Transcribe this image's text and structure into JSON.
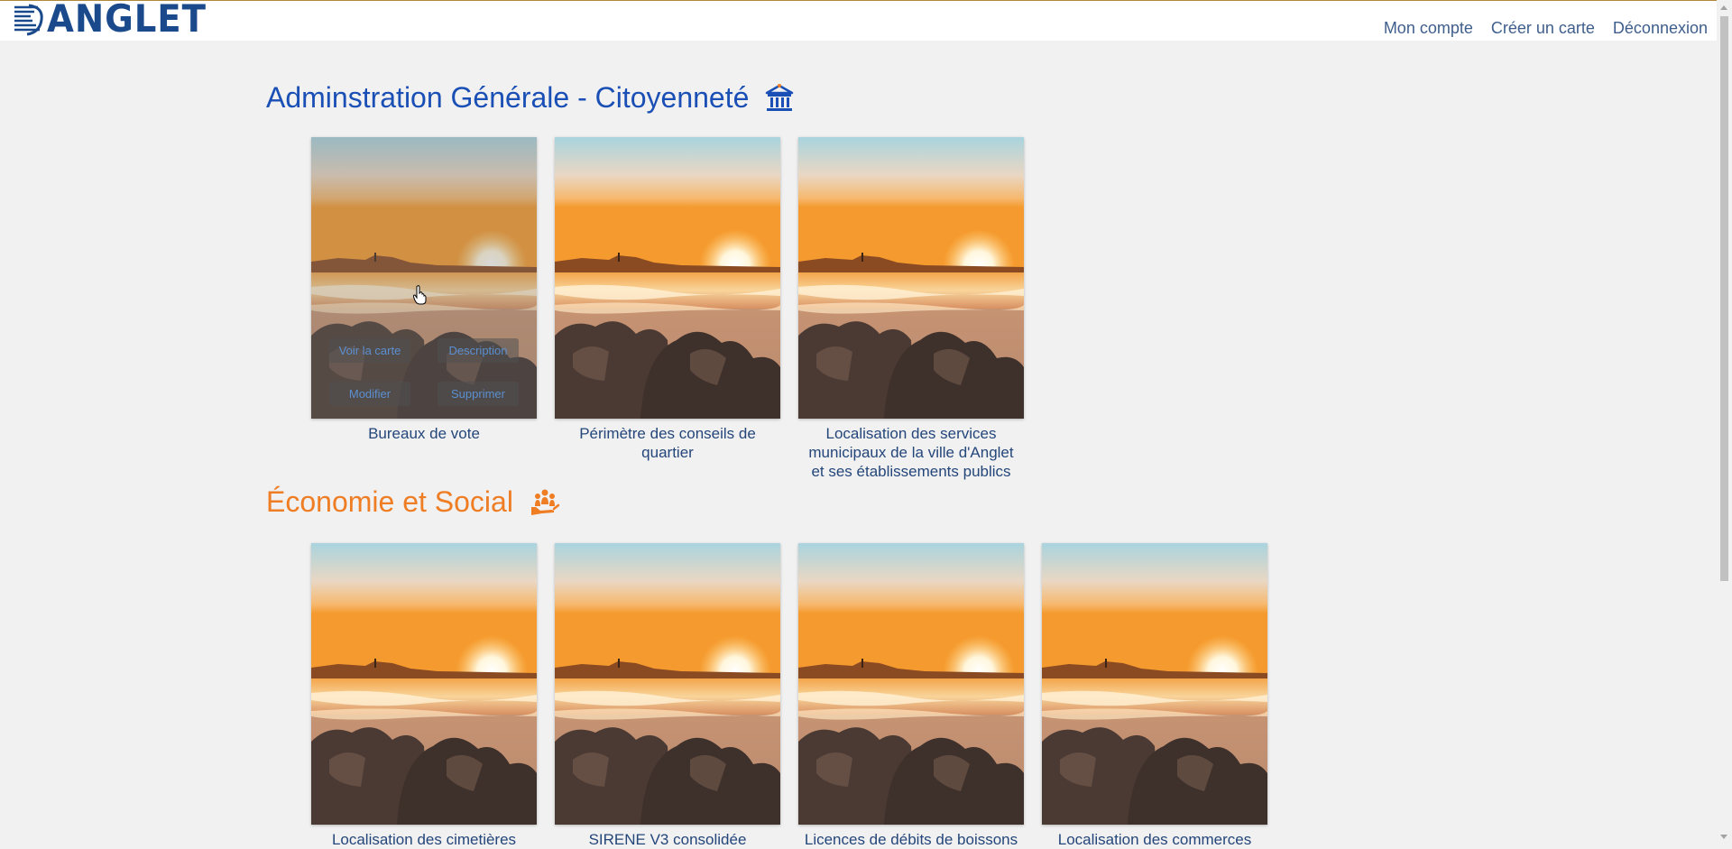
{
  "header": {
    "logo_text": "ANGLET",
    "nav": [
      "Mon compte",
      "Créer un carte",
      "Déconnexion"
    ]
  },
  "sections": [
    {
      "title": "Adminstration Générale - Citoyenneté",
      "color": "#1a4fb5",
      "icon": "government-building-icon",
      "cards": [
        {
          "caption": "Bureaux de vote"
        },
        {
          "caption": "Périmètre des conseils de quartier"
        },
        {
          "caption": "Localisation des services municipaux de la ville d'Anglet et ses établissements publics"
        }
      ]
    },
    {
      "title": "Économie et Social",
      "color": "#ee7d24",
      "icon": "community-hand-icon",
      "cards": [
        {
          "caption": "Localisation des cimetières"
        },
        {
          "caption": "SIRENE V3 consolidée"
        },
        {
          "caption": "Licences de débits de boissons"
        },
        {
          "caption": "Localisation des commerces"
        }
      ]
    }
  ],
  "card_actions": {
    "view": "Voir la carte",
    "description": "Description",
    "edit": "Modifier",
    "delete": "Supprimer"
  }
}
